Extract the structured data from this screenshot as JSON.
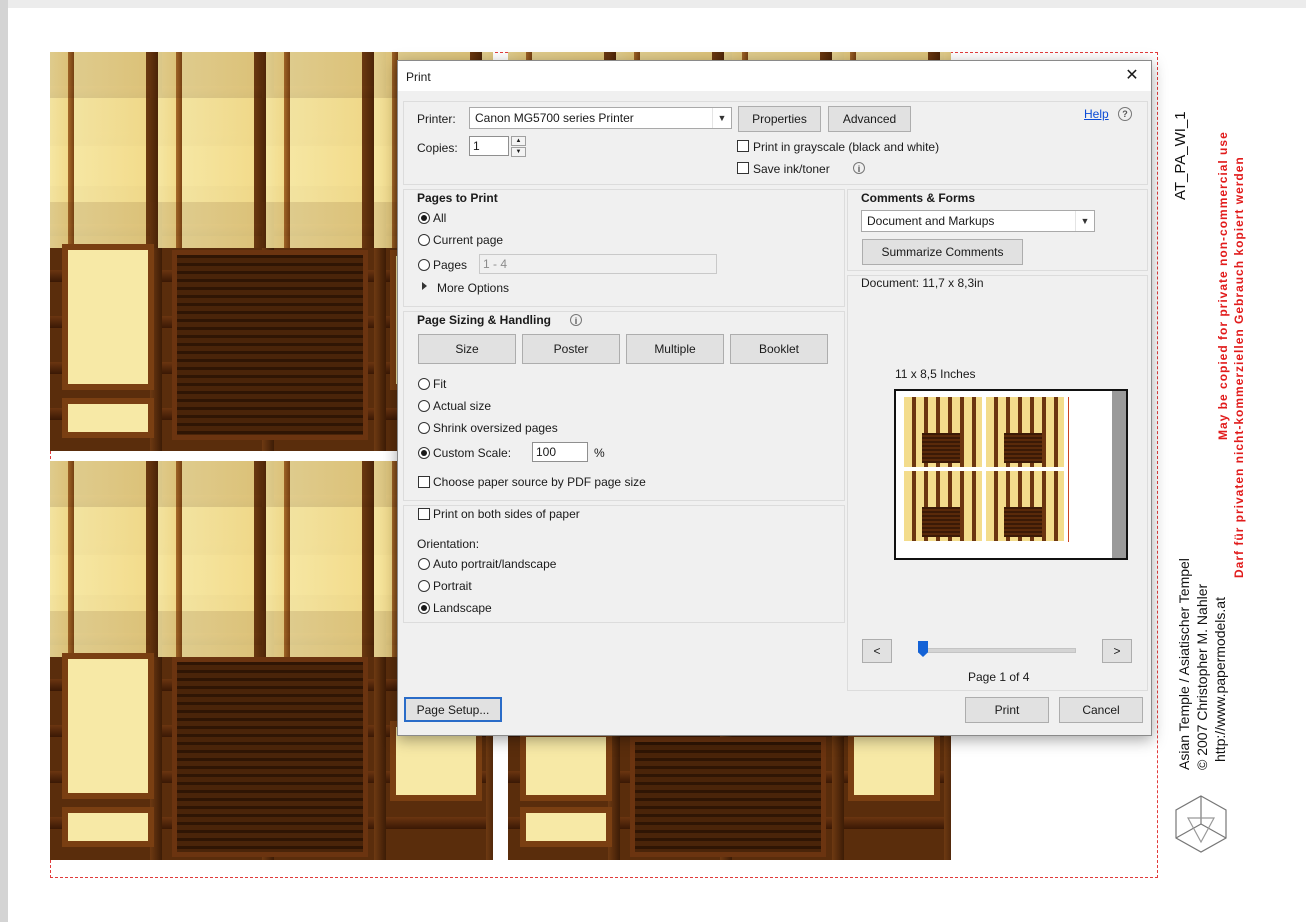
{
  "background": {
    "doc_code": "AT_PA_WI_1",
    "notice_en": "May be copied for private non-commercial use",
    "notice_de": "Darf für privaten nicht-kommerziellen Gebrauch kopiert werden",
    "credit_line1": "Asian Temple / Asiatischer Tempel",
    "credit_line2": "© 2007  Christopher M. Nahler",
    "credit_line3": "http://www.papermodels.at"
  },
  "dialog": {
    "title": "Print",
    "close": "✕",
    "printer_label": "Printer:",
    "printer_value": "Canon MG5700 series Printer",
    "properties_button": "Properties",
    "advanced_button": "Advanced",
    "help_link": "Help",
    "copies_label": "Copies:",
    "copies_value": "1",
    "grayscale_label": "Print in grayscale (black and white)",
    "save_ink_label": "Save ink/toner",
    "pages_to_print": {
      "heading": "Pages to Print",
      "all": "All",
      "current_page": "Current page",
      "pages": "Pages",
      "pages_value": "1 - 4",
      "more_options": "More Options"
    },
    "sizing": {
      "heading": "Page Sizing & Handling",
      "size_button": "Size",
      "poster_button": "Poster",
      "multiple_button": "Multiple",
      "booklet_button": "Booklet",
      "fit": "Fit",
      "actual_size": "Actual size",
      "shrink": "Shrink oversized pages",
      "custom_scale": "Custom Scale:",
      "custom_scale_value": "100",
      "percent": "%",
      "paper_source": "Choose paper source by PDF page size"
    },
    "both_sides": "Print on both sides of paper",
    "orientation": {
      "heading": "Orientation:",
      "auto": "Auto portrait/landscape",
      "portrait": "Portrait",
      "landscape": "Landscape"
    },
    "comments": {
      "heading": "Comments & Forms",
      "value": "Document and Markups",
      "summarize_button": "Summarize Comments"
    },
    "preview": {
      "document_size": "Document: 11,7 x 8,3in",
      "paper_size": "11 x 8,5 Inches",
      "prev": "<",
      "next": ">",
      "page_indicator": "Page 1 of 4",
      "slider_position": 0
    },
    "page_setup_button": "Page Setup...",
    "print_button": "Print",
    "cancel_button": "Cancel"
  }
}
